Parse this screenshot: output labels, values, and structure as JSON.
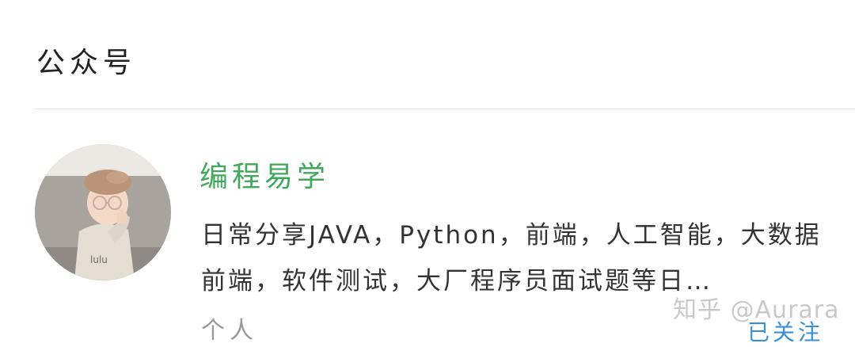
{
  "section": {
    "title": "公众号"
  },
  "account": {
    "name": "编程易学",
    "description": "日常分享JAVA，Python，前端，人工智能，大数据前端，软件测试，大厂程序员面试题等日…",
    "type": "个人",
    "follow_status": "已关注",
    "avatar_icon": "child-avatar-image"
  },
  "watermark": {
    "text": "知乎 @Aurara"
  },
  "colors": {
    "name": "#3fa85a",
    "follow": "#3a8fd9",
    "meta": "#9a9a9a"
  }
}
